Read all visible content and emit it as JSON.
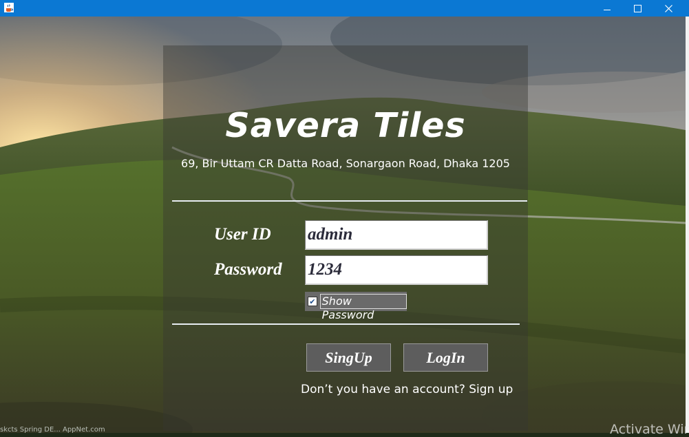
{
  "window": {
    "app_icon": "java-coffee-cup-icon",
    "controls": [
      "minimize-icon",
      "maximize-icon",
      "close-icon"
    ]
  },
  "brand": {
    "name": "Savera Tiles",
    "address": "69, Bir Uttam CR Datta Road, Sonargaon Road, Dhaka 1205"
  },
  "form": {
    "user_label": "User ID",
    "user_value": "admin",
    "password_label": "Password",
    "password_value": "1234",
    "show_password_label": "Show Password",
    "show_password_checked": true,
    "signup_button": "SingUp",
    "login_button": "LogIn",
    "signup_prompt": "Don’t you have an account? Sign up"
  },
  "background": {
    "taskbar_ghost_text": "skcts   Spring DE...   AppNet.com",
    "watermark": "Activate Win"
  },
  "colors": {
    "titlebar": "#0b78d3",
    "panel_overlay": "rgba(55,55,50,0.42)",
    "button": "#5d5d5d"
  }
}
